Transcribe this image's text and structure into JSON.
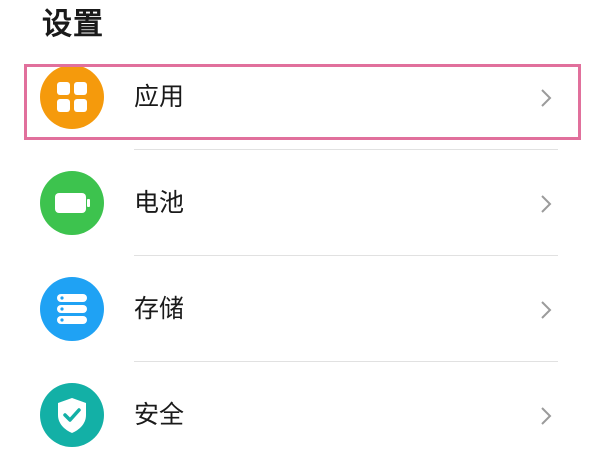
{
  "header": {
    "title": "设置"
  },
  "settings": {
    "items": [
      {
        "label": "应用",
        "icon": "apps-grid-icon",
        "icon_color": "#f59a0c"
      },
      {
        "label": "电池",
        "icon": "battery-icon",
        "icon_color": "#3dc34e"
      },
      {
        "label": "存储",
        "icon": "storage-icon",
        "icon_color": "#1fa2f4"
      },
      {
        "label": "安全",
        "icon": "security-shield-icon",
        "icon_color": "#13b0a6"
      }
    ]
  },
  "highlight": {
    "target": "应用",
    "color": "#e1709c"
  }
}
